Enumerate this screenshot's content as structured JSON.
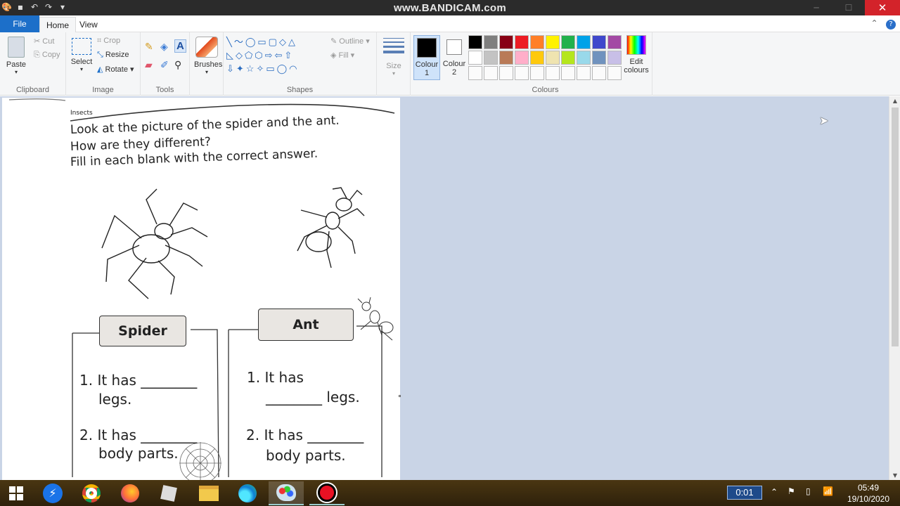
{
  "window": {
    "watermark": "www.BANDICAM.com",
    "close_glyph": "✕"
  },
  "tabs": [
    {
      "label": "File"
    },
    {
      "label": "Home"
    },
    {
      "label": "View"
    }
  ],
  "ribbon": {
    "clipboard": {
      "paste": "Paste",
      "cut": "Cut",
      "copy": "Copy",
      "label": "Clipboard"
    },
    "image": {
      "select": "Select",
      "crop": "Crop",
      "resize": "Resize",
      "rotate": "Rotate",
      "label": "Image"
    },
    "tools": {
      "label": "Tools"
    },
    "brushes": {
      "label": "Brushes"
    },
    "shapes": {
      "outline": "Outline",
      "fill": "Fill",
      "label": "Shapes"
    },
    "size": {
      "label": "Size"
    },
    "colour1": {
      "label": "Colour",
      "num": "1"
    },
    "colour2": {
      "label": "Colour",
      "num": "2"
    },
    "colours": {
      "label": "Colours",
      "edit_line1": "Edit",
      "edit_line2": "colours"
    },
    "palette_row1": [
      "#000000",
      "#7f7f7f",
      "#880015",
      "#ed1c24",
      "#ff7f27",
      "#fff200",
      "#22b14c",
      "#00a2e8",
      "#3f48cc",
      "#a349a4"
    ],
    "palette_row2": [
      "#ffffff",
      "#c3c3c3",
      "#b97a57",
      "#ffaec9",
      "#ffc90e",
      "#efe4b0",
      "#b5e61d",
      "#99d9ea",
      "#7092be",
      "#c8bfe7"
    ]
  },
  "worksheet": {
    "section": "Insects",
    "line1": "Look at the picture of the spider and the ant.",
    "line2": "How are they different?",
    "line3": "Fill in each blank with the correct answer.",
    "spider_title": "Spider",
    "ant_title": "Ant",
    "spider_q1a": "1.  It has ________",
    "spider_q1b": "legs.",
    "spider_q2a": "2.  It has ________",
    "spider_q2b": "body parts.",
    "ant_q1a": "1.  It has",
    "ant_q1b": "________ legs.",
    "ant_q2a": "2.  It has ________",
    "ant_q2b": "body parts."
  },
  "taskbar": {
    "timer": "0:01",
    "time": "05:49",
    "date": "19/10/2020"
  }
}
